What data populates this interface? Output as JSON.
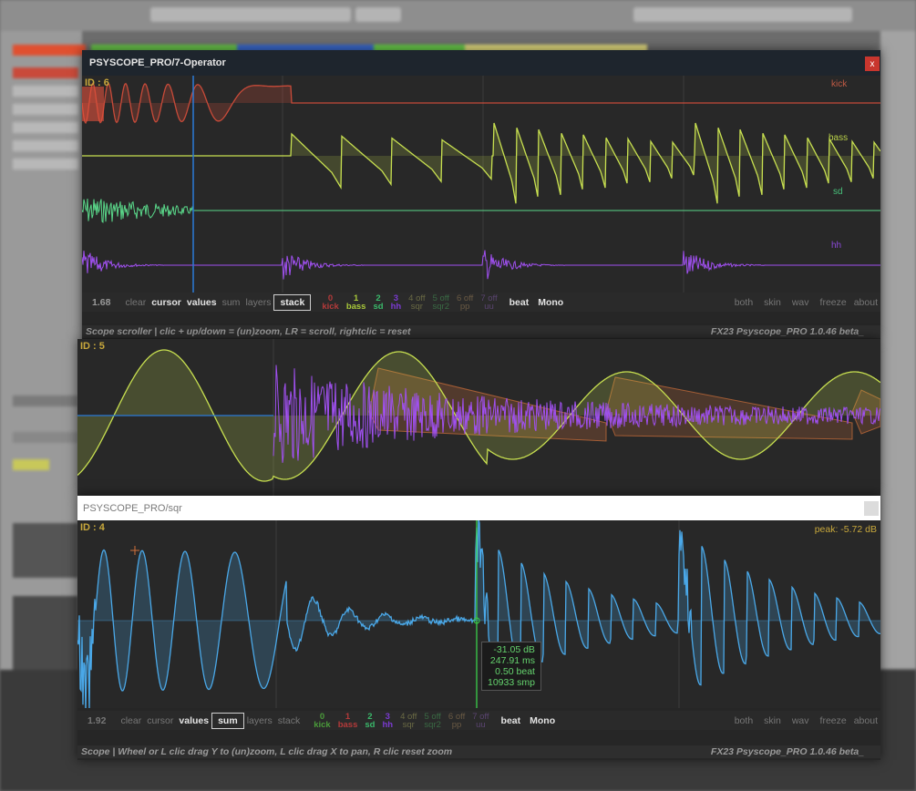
{
  "win1": {
    "title": "PSYSCOPE_PRO/7-Operator",
    "close": "x",
    "id_label": "ID : 6",
    "tracks": [
      "kick",
      "bass",
      "sd",
      "hh"
    ],
    "toolbar": {
      "value": "1.68",
      "clear": "clear",
      "cursor": "cursor",
      "values": "values",
      "sum": "sum",
      "layers": "layers",
      "stack": "stack",
      "layers_list": [
        {
          "num": "0",
          "name": "kick",
          "color": "#b33a3a"
        },
        {
          "num": "1",
          "name": "bass",
          "color": "#a8c83a"
        },
        {
          "num": "2",
          "name": "sd",
          "color": "#3ab86a"
        },
        {
          "num": "3",
          "name": "hh",
          "color": "#7a3ad0"
        },
        {
          "num": "4 off",
          "name": "sqr",
          "color": "#6a6a44"
        },
        {
          "num": "5 off",
          "name": "sqr2",
          "color": "#3a6a44"
        },
        {
          "num": "6 off",
          "name": "pp",
          "color": "#6a5a44"
        },
        {
          "num": "7 off",
          "name": "uu",
          "color": "#5a4470"
        }
      ],
      "beat": "beat",
      "mono": "Mono",
      "both": "both",
      "skin": "skin",
      "wav": "wav",
      "freeze": "freeze",
      "about": "about"
    },
    "status_left": "Scope scroller | clic + up/down = (un)zoom, LR = scroll, rightclic = reset",
    "status_right": "FX23 Psyscope_PRO 1.0.46 beta_"
  },
  "win2": {
    "id_label": "ID : 5"
  },
  "win3": {
    "title": "PSYSCOPE_PRO/sqr",
    "id_label": "ID : 4",
    "peak": "peak: -5.72 dB",
    "readout": [
      "-31.05 dB",
      "247.91 ms",
      "0.50 beat",
      "10933 smp"
    ],
    "toolbar": {
      "value": "1.92",
      "clear": "clear",
      "cursor": "cursor",
      "values": "values",
      "sum": "sum",
      "layers": "layers",
      "stack": "stack",
      "layers_list": [
        {
          "num": "0",
          "name": "kick",
          "color": "#4a9a3a"
        },
        {
          "num": "1",
          "name": "bass",
          "color": "#b33a3a"
        },
        {
          "num": "2",
          "name": "sd",
          "color": "#3ab86a"
        },
        {
          "num": "3",
          "name": "hh",
          "color": "#7a3ad0"
        },
        {
          "num": "4 off",
          "name": "sqr",
          "color": "#6a6a44"
        },
        {
          "num": "5 off",
          "name": "sqr2",
          "color": "#3a6a44"
        },
        {
          "num": "6 off",
          "name": "pp",
          "color": "#6a5a44"
        },
        {
          "num": "7 off",
          "name": "uu",
          "color": "#5a4470"
        }
      ],
      "beat": "beat",
      "mono": "Mono",
      "both": "both",
      "skin": "skin",
      "wav": "wav",
      "freeze": "freeze",
      "about": "about"
    },
    "status_left": "Scope | Wheel or L clic drag Y to (un)zoom, L clic drag X to pan, R clic reset zoom",
    "status_right": "FX23 Psyscope_PRO 1.0.46 beta_"
  },
  "colors": {
    "kick": "#e0503c",
    "bass": "#c8e050",
    "sd": "#5ad88a",
    "hh": "#a050f0",
    "sqr": "#4aa8e8",
    "cursor": "#2a7ad8",
    "cursor_green": "#3ad04a",
    "window_bg": "#262626",
    "titlebar": "#1e252d"
  }
}
